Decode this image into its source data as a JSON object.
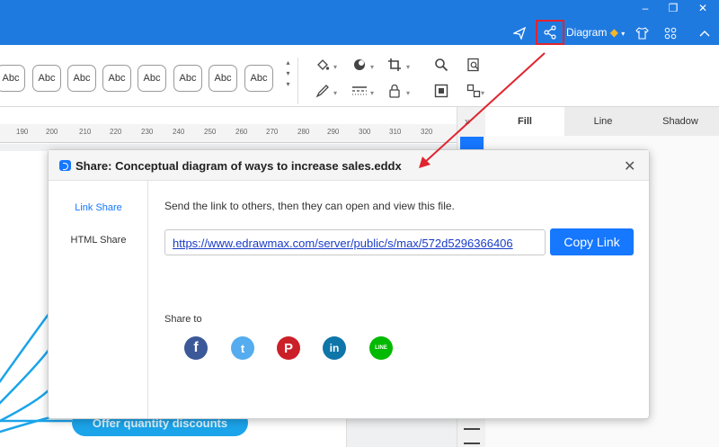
{
  "app": {
    "diagram_label": "Diagram",
    "colors": {
      "brand": "#1f7ae0",
      "accent": "#1677ff",
      "highlight_box": "#e0242f",
      "annotation_arrow": "#e0242f"
    }
  },
  "window_controls": [
    "minimize",
    "restore",
    "close"
  ],
  "ribbon": {
    "style_samples": [
      "Abc",
      "Abc",
      "Abc",
      "Abc",
      "Abc",
      "Abc",
      "Abc",
      "Abc"
    ],
    "tools": [
      "fill-icon",
      "shape-icon",
      "crop-icon",
      "search-icon",
      "find-replace-icon",
      "pen-icon",
      "line-style-icon",
      "lock-icon",
      "fit-icon",
      "arrange-icon"
    ]
  },
  "ruler": {
    "ticks": [
      "190",
      "200",
      "210",
      "220",
      "230",
      "240",
      "250",
      "260",
      "270",
      "280",
      "290",
      "300",
      "310",
      "320"
    ]
  },
  "canvas": {
    "shape_label": "Offer quantity discounts"
  },
  "right_panel": {
    "tabs": [
      "Fill",
      "Line",
      "Shadow"
    ],
    "active_tab": "Fill"
  },
  "dialog": {
    "title": "Share: Conceptual diagram of ways to increase sales.eddx",
    "nav": [
      {
        "label": "Link Share",
        "active": true
      },
      {
        "label": "HTML Share",
        "active": false
      }
    ],
    "description": "Send the link to others, then they can open and view this file.",
    "link": "https://www.edrawmax.com/server/public/s/max/572d5296366406",
    "copy_button": "Copy Link",
    "share_to_label": "Share to",
    "social": [
      {
        "name": "facebook-icon",
        "glyph": "f",
        "color": "#3b5998"
      },
      {
        "name": "twitter-icon",
        "glyph": "t",
        "color": "#55acee"
      },
      {
        "name": "pinterest-icon",
        "glyph": "P",
        "color": "#cb2027"
      },
      {
        "name": "linkedin-icon",
        "glyph": "in",
        "color": "#0e76a8"
      },
      {
        "name": "line-icon",
        "glyph": "LINE",
        "color": "#00b900"
      }
    ]
  }
}
